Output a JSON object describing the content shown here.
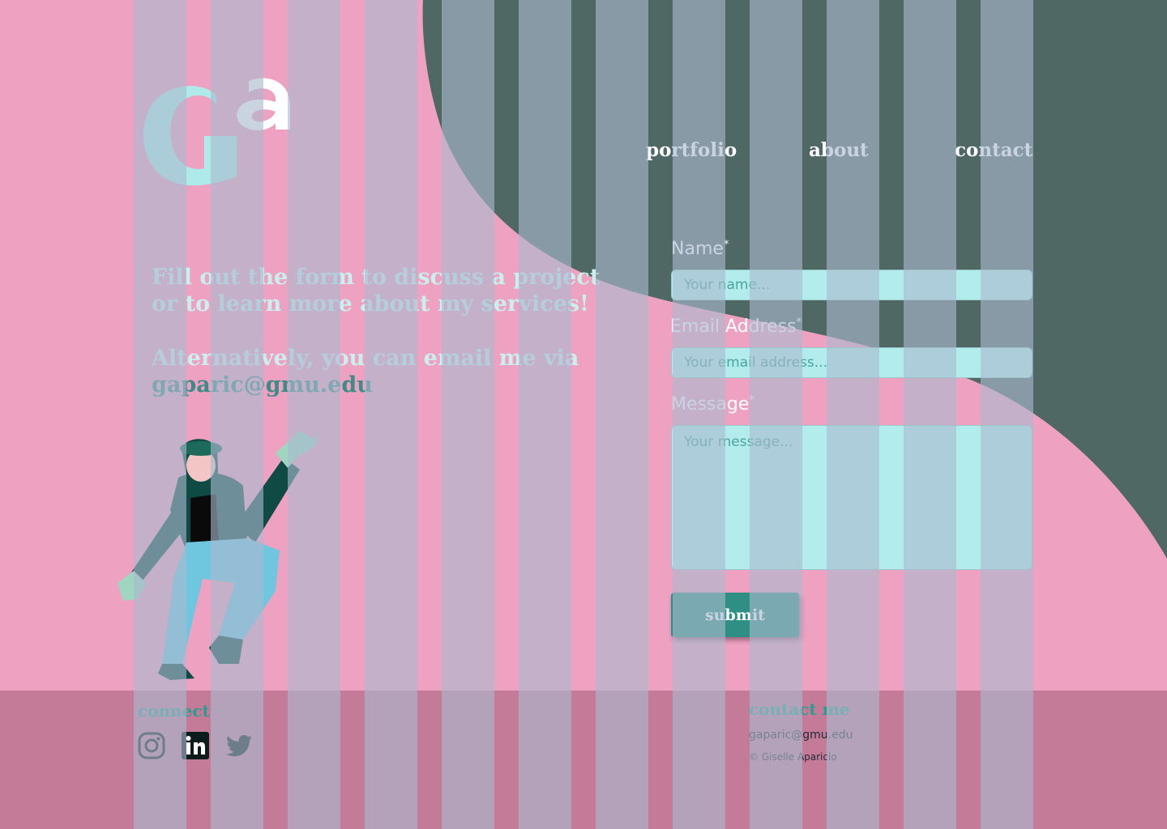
{
  "colors": {
    "background": "#eea1c1",
    "wave": "#4f6864",
    "teal_text": "#2a9d92",
    "field_bg": "#b3ecec",
    "button": "#2f8f84",
    "footer": "#c47b98"
  },
  "logo": {
    "icon": "ga-monogram-logo"
  },
  "nav": {
    "portfolio": "portfolio",
    "about": "about",
    "contact": "contact"
  },
  "intro": {
    "line": "Fill out the form to discuss a project or to learn more about my services!",
    "alt_line": "Alternatively, you can email me via",
    "email": "gaparic@gmu.edu"
  },
  "illustration": {
    "icon": "waving-woman-illustration"
  },
  "form": {
    "name_label": "Name",
    "name_placeholder": "Your name...",
    "email_label": "Email Address",
    "email_placeholder": "Your email address...",
    "message_label": "Message",
    "message_placeholder": "Your message...",
    "required_mark": "*",
    "submit_label": "submit"
  },
  "footer": {
    "connect_heading": "connect",
    "social_icons": [
      "instagram-icon",
      "linkedin-icon",
      "twitter-icon"
    ],
    "contact_heading": "contact me",
    "email": "gaparic@gmu.edu",
    "copyright": "© Giselle Aparicio"
  }
}
